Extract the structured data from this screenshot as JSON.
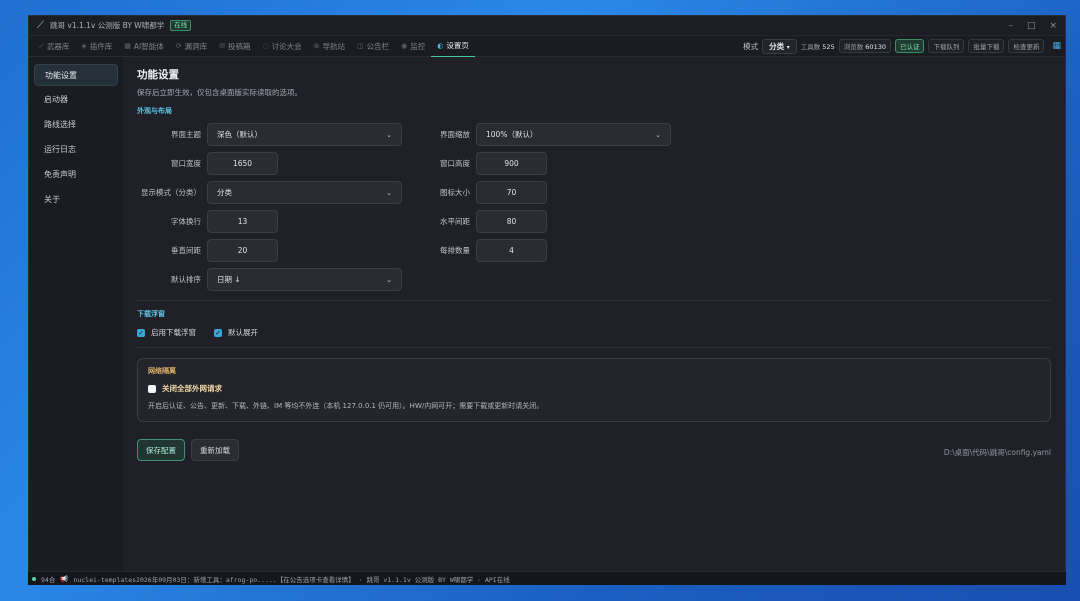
{
  "window": {
    "title": "跳哥 v1.1.1v 公测版 BY W啸都学",
    "status_badge": "在线",
    "controls": [
      "–",
      "□",
      "×"
    ]
  },
  "nav": {
    "tabs": [
      {
        "label": "武器库",
        "icon": "sword-icon",
        "glyph": "⟋"
      },
      {
        "label": "插件库",
        "icon": "plugin-icon",
        "glyph": "◈"
      },
      {
        "label": "AI智能体",
        "icon": "ai-icon",
        "glyph": "▦"
      },
      {
        "label": "漏洞库",
        "icon": "refresh-icon",
        "glyph": "⟳"
      },
      {
        "label": "投稿箱",
        "icon": "inbox-icon",
        "glyph": "✉"
      },
      {
        "label": "讨论大会",
        "icon": "chat-icon",
        "glyph": "◌"
      },
      {
        "label": "导航站",
        "icon": "compass-icon",
        "glyph": "⊛"
      },
      {
        "label": "公告栏",
        "icon": "bell-icon",
        "glyph": "◫"
      },
      {
        "label": "监控",
        "icon": "monitor-icon",
        "glyph": "◉"
      },
      {
        "label": "设置页",
        "icon": "settings-icon",
        "glyph": "◐"
      }
    ],
    "mode_label": "模式",
    "mode_value": "分类",
    "tools_label": "工具数",
    "tools_count": "525",
    "views_label": "浏览数",
    "views_count": "60130",
    "verified": "已认证",
    "download_queue": "下载队列",
    "batch_download": "批量下载",
    "check_update": "检查更新"
  },
  "sidebar": {
    "items": [
      "功能设置",
      "启动器",
      "路线选择",
      "运行日志",
      "免责声明",
      "关于"
    ]
  },
  "main": {
    "title": "功能设置",
    "subtitle": "保存后立即生效，仅包含桌面版实际读取的选项。",
    "section_appearance": "外观与布局",
    "fields": {
      "theme": {
        "label": "界面主题",
        "value": "深色（默认）"
      },
      "zoom": {
        "label": "界面缩放",
        "value": "100%（默认）"
      },
      "width": {
        "label": "窗口宽度",
        "value": "1650"
      },
      "height": {
        "label": "窗口高度",
        "value": "900"
      },
      "display_mode": {
        "label": "显示模式（分类）",
        "value": "分类"
      },
      "icon_size": {
        "label": "图标大小",
        "value": "70"
      },
      "font_line": {
        "label": "字体换行",
        "value": "13"
      },
      "h_spacing": {
        "label": "水平间距",
        "value": "80"
      },
      "v_spacing": {
        "label": "垂直间距",
        "value": "20"
      },
      "per_row": {
        "label": "每排数量",
        "value": "4"
      },
      "sort": {
        "label": "默认排序",
        "value": "日期 ↓"
      }
    },
    "section_download": "下载浮窗",
    "enable_float": "启用下载浮窗",
    "default_expand": "默认展开",
    "network": {
      "title": "网络隔离",
      "checkbox": "关闭全部外网请求",
      "desc": "开启后认证、公告、更新、下载、外链、IM 等均不外连（本机 127.0.0.1 仍可用）。HW/内网可开；需要下载或更新时请关闭。"
    },
    "save": "保存配置",
    "reload": "重新加载",
    "config_path": "D:\\桌面\\代码\\跳哥\\config.yaml"
  },
  "status": {
    "online": "94合",
    "message": "nuclei-templates2026年09月03日：新增工具：afrog-po.....【在公告选项卡查看详情】 · 跳哥 v1.1.1v 公测版 BY W啸都学 · API在线"
  }
}
